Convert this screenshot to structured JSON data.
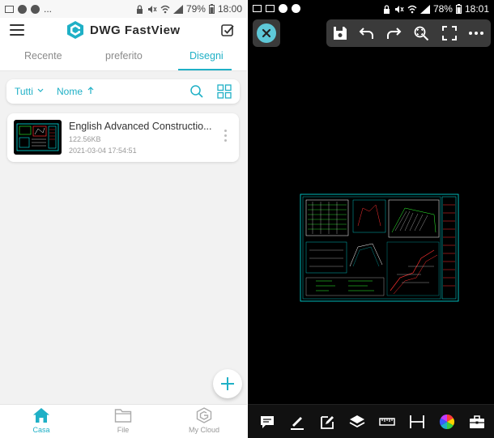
{
  "left_screen": {
    "status_bar": {
      "battery": "79%",
      "time": "18:00",
      "more": "..."
    },
    "app_title": "DWG FastView",
    "tabs": [
      {
        "label": "Recente",
        "active": false
      },
      {
        "label": "preferito",
        "active": false
      },
      {
        "label": "Disegni",
        "active": true
      }
    ],
    "filter": {
      "type_label": "Tutti",
      "sort_label": "Nome"
    },
    "files": [
      {
        "name": "English Advanced Constructio...",
        "size": "122.56KB",
        "date": "2021-03-04 17:54:51"
      }
    ],
    "bottom_nav": [
      {
        "label": "Casa",
        "icon": "home-icon",
        "active": true
      },
      {
        "label": "File",
        "icon": "folder-icon",
        "active": false
      },
      {
        "label": "My Cloud",
        "icon": "cloud-logo-icon",
        "active": false
      }
    ]
  },
  "right_screen": {
    "status_bar": {
      "battery": "78%",
      "time": "18:01"
    },
    "top_toolbar": [
      "save-icon",
      "undo-icon",
      "redo-icon",
      "zoom-extents-icon",
      "fullscreen-icon",
      "more-icon"
    ],
    "bottom_toolbar": [
      "comment-icon",
      "pen-icon",
      "edit-icon",
      "layers-icon",
      "ruler-icon",
      "dimension-icon",
      "color-wheel-icon",
      "toolbox-icon"
    ]
  },
  "colors": {
    "accent": "#1fb0c6",
    "close_button": "#5ec8d8",
    "toolbar_bg": "#3a3a3a",
    "cad_cyan": "#00e5e5",
    "cad_red": "#ff3030",
    "cad_green": "#30ff30",
    "cad_white": "#ffffff"
  }
}
